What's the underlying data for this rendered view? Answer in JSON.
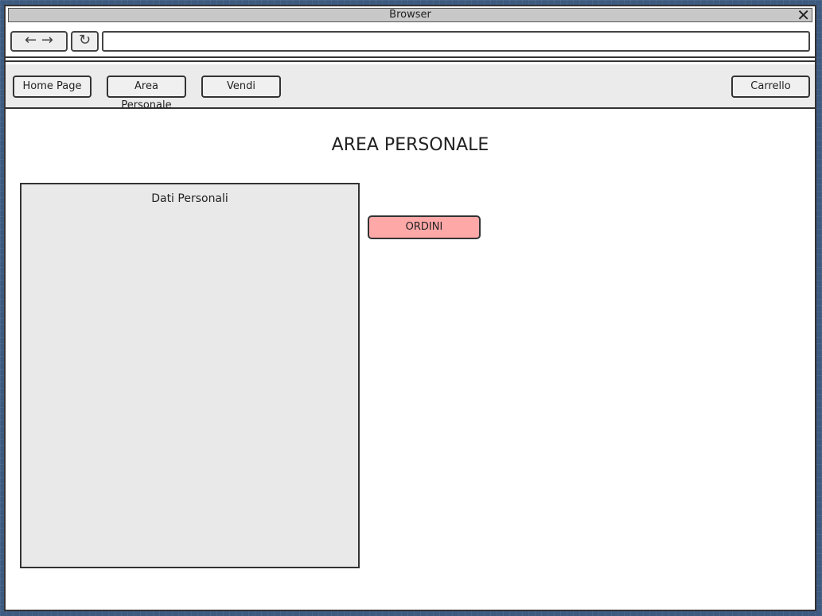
{
  "window": {
    "title": "Browser"
  },
  "browser": {
    "url": ""
  },
  "menu": {
    "home": "Home Page",
    "area": "Area Personale",
    "vendi": "Vendi",
    "carrello": "Carrello"
  },
  "page": {
    "title": "AREA PERSONALE",
    "panel_label": "Dati Personali",
    "ordini_label": "ORDINI"
  },
  "colors": {
    "menubar_bg": "#ebebeb",
    "panel_bg": "#e9e9e9",
    "ordini_bg": "#ffa8a8"
  }
}
